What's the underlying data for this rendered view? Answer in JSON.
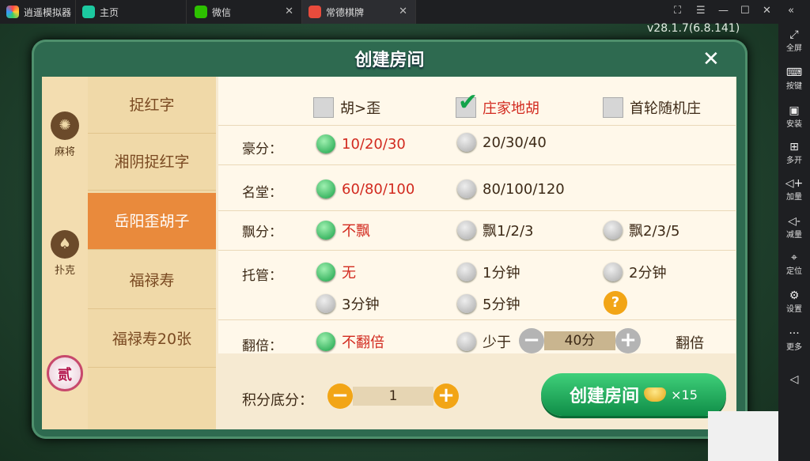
{
  "titlebar": {
    "app_name": "逍遥模拟器",
    "tabs": [
      {
        "label": "主页"
      },
      {
        "label": "微信"
      },
      {
        "label": "常德棋牌"
      }
    ],
    "controls": [
      "restore-icon",
      "menu-icon",
      "minimize-icon",
      "maximize-icon",
      "close-icon",
      "collapse-icon"
    ]
  },
  "version": "v28.1.7(6.8.141)",
  "sidebar": {
    "items": [
      {
        "icon": "fullscreen-icon",
        "label": "全屏"
      },
      {
        "icon": "keyboard-icon",
        "label": "按键"
      },
      {
        "icon": "apk-icon",
        "label": "安装"
      },
      {
        "icon": "multi-open-icon",
        "label": "多开"
      },
      {
        "icon": "volume-up-icon",
        "label": "加量"
      },
      {
        "icon": "volume-down-icon",
        "label": "减量"
      },
      {
        "icon": "location-icon",
        "label": "定位"
      },
      {
        "icon": "settings-icon",
        "label": "设置"
      },
      {
        "icon": "more-icon",
        "label": "更多"
      }
    ]
  },
  "dialog": {
    "title": "创建房间",
    "categories": [
      {
        "label": "麻将",
        "icon": "mahjong-icon"
      },
      {
        "label": "扑克",
        "icon": "spade-icon"
      },
      {
        "label": "",
        "icon": "er-badge-icon",
        "glyph": "贰"
      }
    ],
    "games": [
      "捉红字",
      "湘阴捉红字",
      "岳阳歪胡子",
      "福禄寿",
      "福禄寿20张"
    ],
    "selected_game": "岳阳歪胡子",
    "checks": [
      {
        "label": "胡>歪",
        "checked": false
      },
      {
        "label": "庄家地胡",
        "checked": true
      },
      {
        "label": "首轮随机庄",
        "checked": false
      }
    ],
    "haofen": {
      "label": "豪分：",
      "options": [
        "10/20/30",
        "20/30/40"
      ],
      "selected": 0
    },
    "mingtang": {
      "label": "名堂：",
      "options": [
        "60/80/100",
        "80/100/120"
      ],
      "selected": 0
    },
    "piaofen": {
      "label": "飘分：",
      "options": [
        "不飘",
        "飘1/2/3",
        "飘2/3/5"
      ],
      "selected": 0
    },
    "tuoguan": {
      "label": "托管：",
      "options": [
        "无",
        "1分钟",
        "2分钟",
        "3分钟",
        "5分钟"
      ],
      "selected": 0
    },
    "fanbei": {
      "label": "翻倍：",
      "option_none": "不翻倍",
      "less_than": "少于",
      "value": "40分",
      "suffix": "翻倍"
    },
    "jifen": {
      "label": "积分底分：",
      "value": "1"
    },
    "create_button": {
      "label": "创建房间",
      "cost": "×15"
    }
  }
}
